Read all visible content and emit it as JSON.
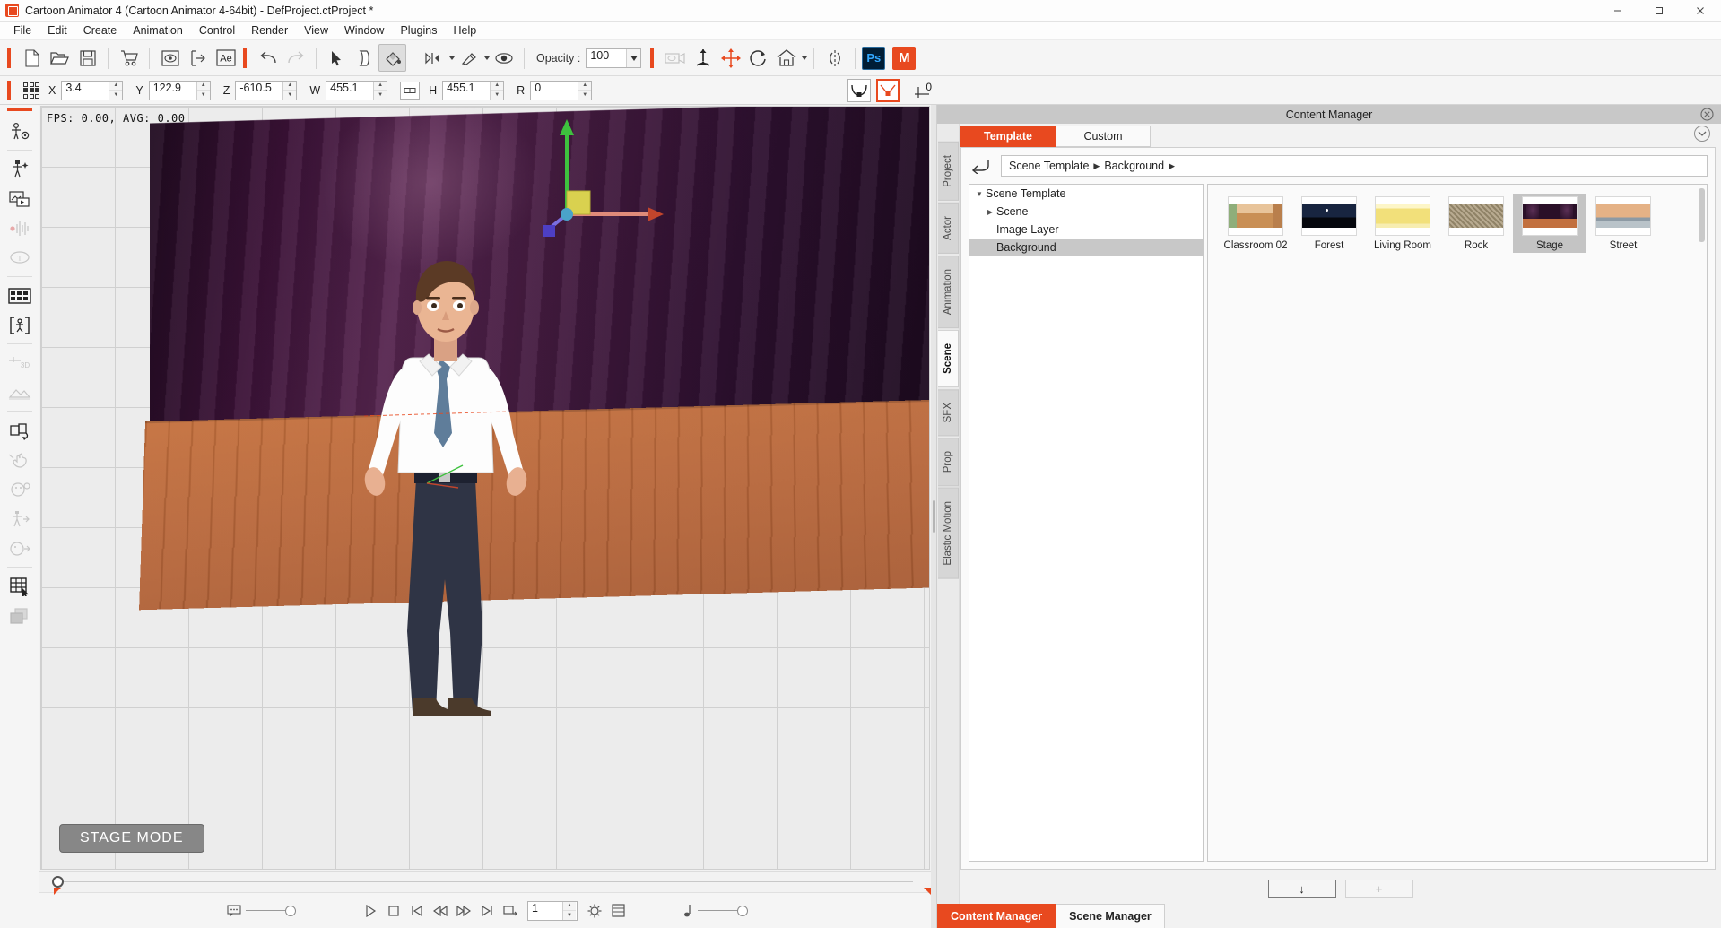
{
  "window": {
    "title": "Cartoon Animator 4  (Cartoon Animator 4-64bit) - DefProject.ctProject *",
    "minimize": "─",
    "maximize": "□",
    "close": "✕"
  },
  "menu": {
    "items": [
      "File",
      "Edit",
      "Create",
      "Animation",
      "Control",
      "Render",
      "View",
      "Window",
      "Plugins",
      "Help"
    ]
  },
  "toolbar": {
    "opacity_label": "Opacity :",
    "opacity_value": "100",
    "ps_label": "Ps",
    "m_label": "M",
    "ae_label": "Ae",
    "icons": [
      "new-project-icon",
      "open-project-icon",
      "save-project-icon",
      "marketplace-icon",
      "preview-icon",
      "export-icon",
      "after-effects-icon",
      "undo-icon",
      "redo-icon",
      "select-tool-icon",
      "transform-tool-icon",
      "paint-bucket-icon",
      "playback-range-icon",
      "link-tool-icon",
      "eye-visibility-icon",
      "camera-preview-icon",
      "pivot-tool-icon",
      "move-tool-icon",
      "rotate-tool-icon",
      "home-view-icon",
      "mirror-icon"
    ]
  },
  "transform": {
    "fields": [
      {
        "label": "X",
        "value": "3.4"
      },
      {
        "label": "Y",
        "value": "122.9"
      },
      {
        "label": "Z",
        "value": "-610.5"
      },
      {
        "label": "W",
        "value": "455.1"
      },
      {
        "label": "H",
        "value": "455.1"
      },
      {
        "label": "R",
        "value": "0"
      }
    ],
    "baseline_value": "0"
  },
  "left_rail": {
    "items": [
      "character-setup-icon",
      "create-actor-icon",
      "image-layer-icon",
      "audio-waveform-icon",
      "text-bubble-icon",
      "sprite-editor-icon",
      "bone-editor-icon",
      "3d-depth-icon",
      "terrain-icon",
      "flip-transform-icon",
      "hand-gesture-icon",
      "face-puppet-icon",
      "body-puppet-icon",
      "head-turn-icon",
      "grid-select-icon",
      "layer-stack-icon"
    ]
  },
  "viewport": {
    "fps_text": "FPS: 0.00, AVG: 0.00",
    "stage_mode_label": "STAGE MODE"
  },
  "timeline": {
    "frame_value": "1",
    "controls": [
      "play-icon",
      "stop-icon",
      "first-frame-icon",
      "prev-frame-icon",
      "next-frame-icon",
      "last-frame-icon",
      "loop-icon"
    ],
    "settings_icon": "settings-gear-icon",
    "timeline_icon": "timeline-icon",
    "note_icon": "audio-note-icon",
    "bubble_icon": "speech-bubble-icon"
  },
  "content_manager": {
    "title": "Content Manager",
    "tabs": [
      {
        "label": "Template",
        "active": true
      },
      {
        "label": "Custom",
        "active": false
      }
    ],
    "breadcrumb": [
      "Scene Template",
      "Background"
    ],
    "side_tabs": [
      {
        "label": "Project",
        "active": false
      },
      {
        "label": "Actor",
        "active": false
      },
      {
        "label": "Animation",
        "active": false
      },
      {
        "label": "Scene",
        "active": true
      },
      {
        "label": "SFX",
        "active": false
      },
      {
        "label": "Prop",
        "active": false
      },
      {
        "label": "Elastic Motion",
        "active": false
      }
    ],
    "tree": [
      {
        "label": "Scene Template",
        "depth": 0,
        "twisty": "open",
        "selected": false
      },
      {
        "label": "Scene",
        "depth": 1,
        "twisty": "closed",
        "selected": false
      },
      {
        "label": "Image Layer",
        "depth": 1,
        "twisty": "none",
        "selected": false
      },
      {
        "label": "Background",
        "depth": 1,
        "twisty": "none",
        "selected": true
      }
    ],
    "thumbnails": [
      {
        "label": "Classroom 02",
        "kind": "classroom",
        "selected": false
      },
      {
        "label": "Forest",
        "kind": "forest",
        "selected": false
      },
      {
        "label": "Living Room",
        "kind": "livingroom",
        "selected": false
      },
      {
        "label": "Rock",
        "kind": "rock",
        "selected": false
      },
      {
        "label": "Stage",
        "kind": "stage",
        "selected": true
      },
      {
        "label": "Street",
        "kind": "street",
        "selected": false
      }
    ],
    "footer": {
      "apply_label": "↓",
      "add_label": "+"
    },
    "bottom_tabs": [
      {
        "label": "Content Manager",
        "active": true
      },
      {
        "label": "Scene Manager",
        "active": false
      }
    ]
  },
  "colors": {
    "accent": "#e8491f",
    "panel": "#f2f2f2",
    "selection": "#c8c8c8"
  }
}
